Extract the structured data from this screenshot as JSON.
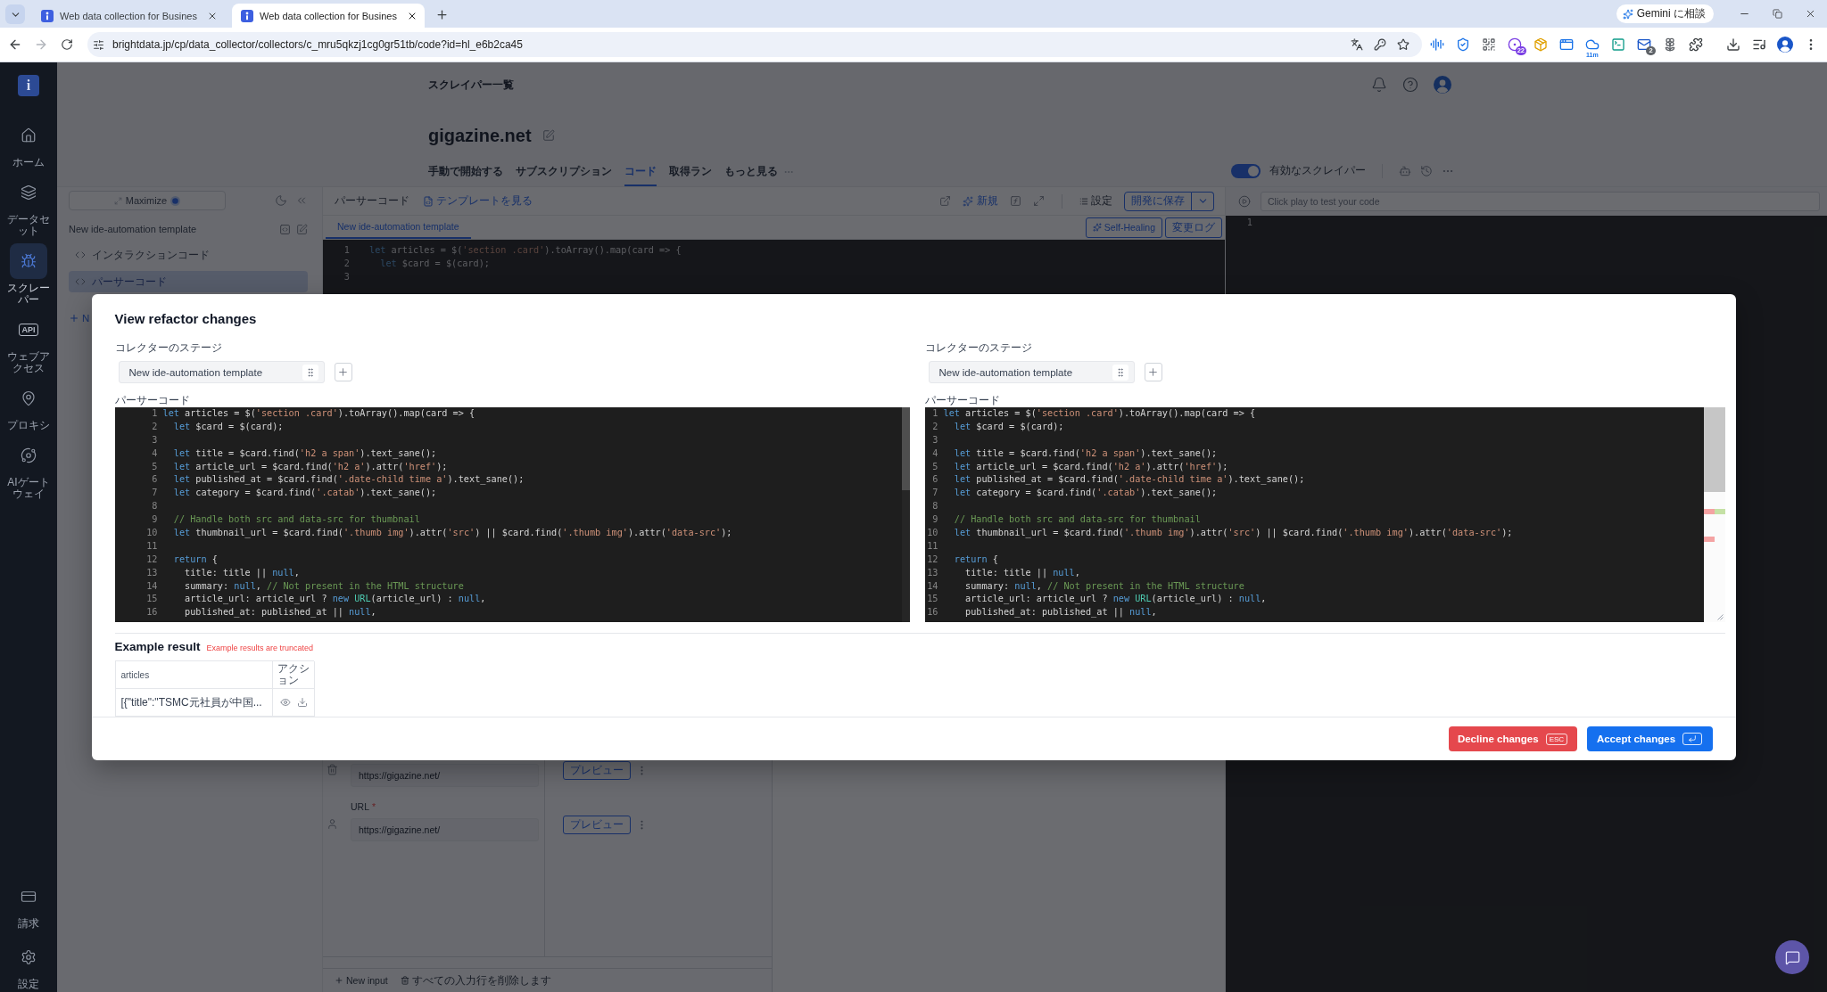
{
  "browser": {
    "tabs": [
      {
        "title": "Web data collection for Busines",
        "selected": false
      },
      {
        "title": "Web data collection for Busines",
        "selected": true
      }
    ],
    "assistant_button": "Gemini に相談",
    "url": "brightdata.jp/cp/data_collector/collectors/c_mru5qkzj1cg0gr51tb/code?id=hl_e6b2ca45",
    "extension_badges": [
      "22",
      "11m",
      "2"
    ]
  },
  "sidebar": {
    "logo": "i",
    "items": [
      {
        "label": "ホーム",
        "selected": false
      },
      {
        "label": "データセット",
        "selected": false
      },
      {
        "label": "スクレーパー",
        "selected": true
      },
      {
        "label": "ウェブアクセス",
        "icon_text": "API",
        "selected": false
      },
      {
        "label": "プロキシ",
        "selected": false
      },
      {
        "label": "AIゲートウェイ",
        "selected": false
      }
    ],
    "bottom_items": [
      {
        "label": "請求",
        "selected": false
      },
      {
        "label": "設定",
        "selected": false
      }
    ]
  },
  "header": {
    "breadcrumb": "スクレイパー一覧",
    "title": "gigazine.net",
    "tabs": [
      {
        "label": "手動で開始する",
        "selected": false
      },
      {
        "label": "サブスクリプション",
        "selected": false
      },
      {
        "label": "コード",
        "selected": true
      },
      {
        "label": "取得ラン",
        "selected": false
      },
      {
        "label": "もっと見る",
        "selected": false
      }
    ],
    "toggle": {
      "label": "有効なスクレイパー",
      "on": true
    }
  },
  "file_panel": {
    "maximize_button": "Maximize",
    "template": "New ide-automation template",
    "files": [
      {
        "label": "インタラクションコード",
        "selected": false
      },
      {
        "label": "パーサーコード",
        "selected": true
      }
    ],
    "add_button": "N"
  },
  "editor_panel": {
    "title": "パーサーコード",
    "template_link": "テンプレートを見る",
    "new_button": "新規",
    "settings_button": "設定",
    "save_button": "開発に保存",
    "tabs": [
      {
        "label": "New ide-automation template",
        "selected": true
      }
    ],
    "self_healing_button": "Self-Healing",
    "changelog_button": "変更ログ",
    "lines": [
      {
        "number": "1",
        "tokens": [
          {
            "kind": "keyword",
            "text": "let"
          },
          {
            "kind": "plain",
            "text": " articles = $("
          },
          {
            "kind": "string",
            "text": "'section .card'"
          },
          {
            "kind": "plain",
            "text": ").toArray().map(card => {"
          }
        ]
      },
      {
        "number": "2",
        "tokens": [
          {
            "kind": "keyword",
            "text": "  let"
          },
          {
            "kind": "plain",
            "text": " $card = $(card);"
          }
        ]
      },
      {
        "number": "3"
      }
    ]
  },
  "inputs": {
    "rows": [
      {
        "value": "https://gigazine.net/",
        "preview_button": "プレビュー"
      },
      {
        "label": "URL",
        "required_mark": "*",
        "value": "https://gigazine.net/",
        "preview_button": "プレビュー"
      }
    ],
    "new_input_button": "New input",
    "clear_button": "すべての入力行を削除します"
  },
  "test_panel": {
    "placeholder": "Click play to test your code",
    "line_numbers": [
      "1"
    ]
  },
  "dialog": {
    "title": "View refactor changes",
    "panes": [
      {
        "kind": "original",
        "stage_label": "コレクターのステージ",
        "stage": "New ide-automation template",
        "code_label": "パーサーコード",
        "lines": [
          {
            "number": "1",
            "tokens": [
              {
                "kind": "keyword",
                "text": "let"
              },
              {
                "kind": "plain",
                "text": " articles = $("
              },
              {
                "kind": "string",
                "text": "'section .card'"
              },
              {
                "kind": "plain",
                "text": ").toArray().map(card => {"
              }
            ]
          },
          {
            "number": "2",
            "tokens": [
              {
                "kind": "keyword",
                "text": "  let"
              },
              {
                "kind": "plain",
                "text": " $card = $(card);"
              }
            ]
          },
          {
            "number": "3"
          },
          {
            "number": "4",
            "tokens": [
              {
                "kind": "keyword",
                "text": "  let"
              },
              {
                "kind": "plain",
                "text": " title = $card.find("
              },
              {
                "kind": "string",
                "text": "'h2 a span'"
              },
              {
                "kind": "plain",
                "text": ").text_sane();"
              }
            ]
          },
          {
            "number": "5",
            "tokens": [
              {
                "kind": "keyword",
                "text": "  let"
              },
              {
                "kind": "plain",
                "text": " article_url = $card.find("
              },
              {
                "kind": "string",
                "text": "'h2 a'"
              },
              {
                "kind": "plain",
                "text": ").attr("
              },
              {
                "kind": "string",
                "text": "'href'"
              },
              {
                "kind": "plain",
                "text": ");"
              }
            ]
          },
          {
            "number": "6",
            "tokens": [
              {
                "kind": "keyword",
                "text": "  let"
              },
              {
                "kind": "plain",
                "text": " published_at = $card.find("
              },
              {
                "kind": "string",
                "text": "'.date-child time a'"
              },
              {
                "kind": "plain",
                "text": ").text_sane();"
              }
            ]
          },
          {
            "number": "7",
            "tokens": [
              {
                "kind": "keyword",
                "text": "  let"
              },
              {
                "kind": "plain",
                "text": " category = $card.find("
              },
              {
                "kind": "string",
                "text": "'.catab'"
              },
              {
                "kind": "plain",
                "text": ").text_sane();"
              }
            ]
          },
          {
            "number": "8"
          },
          {
            "number": "9",
            "tokens": [
              {
                "kind": "comment",
                "text": "  // Handle both src and data-src for thumbnail"
              }
            ]
          },
          {
            "number": "10",
            "tokens": [
              {
                "kind": "keyword",
                "text": "  let"
              },
              {
                "kind": "plain",
                "text": " thumbnail_url = $card.find("
              },
              {
                "kind": "string",
                "text": "'.thumb img'"
              },
              {
                "kind": "plain",
                "text": ").attr("
              },
              {
                "kind": "string",
                "text": "'src'"
              },
              {
                "kind": "plain",
                "text": ") || $card.find("
              },
              {
                "kind": "string",
                "text": "'.thumb img'"
              },
              {
                "kind": "plain",
                "text": ").attr("
              },
              {
                "kind": "string",
                "text": "'data-src'"
              },
              {
                "kind": "plain",
                "text": ");"
              }
            ]
          },
          {
            "number": "11"
          },
          {
            "number": "12",
            "tokens": [
              {
                "kind": "keyword",
                "text": "  return"
              },
              {
                "kind": "plain",
                "text": " {"
              }
            ]
          },
          {
            "number": "13",
            "tokens": [
              {
                "kind": "plain",
                "text": "    title: title || "
              },
              {
                "kind": "keyword",
                "text": "null"
              },
              {
                "kind": "plain",
                "text": ","
              }
            ]
          },
          {
            "number": "14",
            "tokens": [
              {
                "kind": "plain",
                "text": "    summary: "
              },
              {
                "kind": "keyword",
                "text": "null"
              },
              {
                "kind": "plain",
                "text": ", "
              },
              {
                "kind": "comment",
                "text": "// Not present in the HTML structure"
              }
            ]
          },
          {
            "number": "15",
            "tokens": [
              {
                "kind": "plain",
                "text": "    article_url: article_url ? "
              },
              {
                "kind": "keyword",
                "text": "new"
              },
              {
                "kind": "class",
                "text": " URL"
              },
              {
                "kind": "plain",
                "text": "(article_url) : "
              },
              {
                "kind": "keyword",
                "text": "null"
              },
              {
                "kind": "plain",
                "text": ","
              }
            ]
          },
          {
            "number": "16",
            "tokens": [
              {
                "kind": "plain",
                "text": "    published_at: published_at || "
              },
              {
                "kind": "keyword",
                "text": "null"
              },
              {
                "kind": "plain",
                "text": ","
              }
            ]
          }
        ]
      },
      {
        "kind": "modified",
        "stage_label": "コレクターのステージ",
        "stage": "New ide-automation template",
        "code_label": "パーサーコード",
        "lines": [
          {
            "number": "1",
            "tokens": [
              {
                "kind": "keyword",
                "text": "let"
              },
              {
                "kind": "plain",
                "text": " articles = $("
              },
              {
                "kind": "string",
                "text": "'section .card'"
              },
              {
                "kind": "plain",
                "text": ").toArray().map(card => {"
              }
            ]
          },
          {
            "number": "2",
            "tokens": [
              {
                "kind": "keyword",
                "text": "  let"
              },
              {
                "kind": "plain",
                "text": " $card = $(card);"
              }
            ]
          },
          {
            "number": "3"
          },
          {
            "number": "4",
            "tokens": [
              {
                "kind": "keyword",
                "text": "  let"
              },
              {
                "kind": "plain",
                "text": " title = $card.find("
              },
              {
                "kind": "string",
                "text": "'h2 a span'"
              },
              {
                "kind": "plain",
                "text": ").text_sane();"
              }
            ]
          },
          {
            "number": "5",
            "tokens": [
              {
                "kind": "keyword",
                "text": "  let"
              },
              {
                "kind": "plain",
                "text": " article_url = $card.find("
              },
              {
                "kind": "string",
                "text": "'h2 a'"
              },
              {
                "kind": "plain",
                "text": ").attr("
              },
              {
                "kind": "string",
                "text": "'href'"
              },
              {
                "kind": "plain",
                "text": ");"
              }
            ]
          },
          {
            "number": "6",
            "tokens": [
              {
                "kind": "keyword",
                "text": "  let"
              },
              {
                "kind": "plain",
                "text": " published_at = $card.find("
              },
              {
                "kind": "string",
                "text": "'.date-child time a'"
              },
              {
                "kind": "plain",
                "text": ").text_sane();"
              }
            ]
          },
          {
            "number": "7",
            "tokens": [
              {
                "kind": "keyword",
                "text": "  let"
              },
              {
                "kind": "plain",
                "text": " category = $card.find("
              },
              {
                "kind": "string",
                "text": "'.catab'"
              },
              {
                "kind": "plain",
                "text": ").text_sane();"
              }
            ]
          },
          {
            "number": "8"
          },
          {
            "number": "9",
            "tokens": [
              {
                "kind": "comment",
                "text": "  // Handle both src and data-src for thumbnail"
              }
            ]
          },
          {
            "number": "10",
            "tokens": [
              {
                "kind": "keyword",
                "text": "  let"
              },
              {
                "kind": "plain",
                "text": " thumbnail_url = $card.find("
              },
              {
                "kind": "string",
                "text": "'.thumb img'"
              },
              {
                "kind": "plain",
                "text": ").attr("
              },
              {
                "kind": "string",
                "text": "'src'"
              },
              {
                "kind": "plain",
                "text": ") || $card.find("
              },
              {
                "kind": "string",
                "text": "'.thumb img'"
              },
              {
                "kind": "plain",
                "text": ").attr("
              },
              {
                "kind": "string",
                "text": "'data-src'"
              },
              {
                "kind": "plain",
                "text": ");"
              }
            ]
          },
          {
            "number": "11"
          },
          {
            "number": "12",
            "tokens": [
              {
                "kind": "keyword",
                "text": "  return"
              },
              {
                "kind": "plain",
                "text": " {"
              }
            ]
          },
          {
            "number": "13",
            "tokens": [
              {
                "kind": "plain",
                "text": "    title: title || "
              },
              {
                "kind": "keyword",
                "text": "null"
              },
              {
                "kind": "plain",
                "text": ","
              }
            ]
          },
          {
            "number": "14",
            "tokens": [
              {
                "kind": "plain",
                "text": "    summary: "
              },
              {
                "kind": "keyword",
                "text": "null"
              },
              {
                "kind": "plain",
                "text": ", "
              },
              {
                "kind": "comment",
                "text": "// Not present in the HTML structure"
              }
            ]
          },
          {
            "number": "15",
            "tokens": [
              {
                "kind": "plain",
                "text": "    article_url: article_url ? "
              },
              {
                "kind": "keyword",
                "text": "new"
              },
              {
                "kind": "class",
                "text": " URL"
              },
              {
                "kind": "plain",
                "text": "(article_url) : "
              },
              {
                "kind": "keyword",
                "text": "null"
              },
              {
                "kind": "plain",
                "text": ","
              }
            ]
          },
          {
            "number": "16",
            "tokens": [
              {
                "kind": "plain",
                "text": "    published_at: published_at || "
              },
              {
                "kind": "keyword",
                "text": "null"
              },
              {
                "kind": "plain",
                "text": ","
              }
            ]
          }
        ]
      }
    ],
    "example": {
      "title": "Example result",
      "note": "Example results are truncated",
      "columns": [
        "articles",
        "アクション"
      ],
      "rows": [
        {
          "value": "[{\"title\":\"TSMC元社員が中国..."
        }
      ]
    },
    "decline_button": "Decline changes",
    "decline_shortcut": "ESC",
    "accept_button": "Accept changes"
  }
}
